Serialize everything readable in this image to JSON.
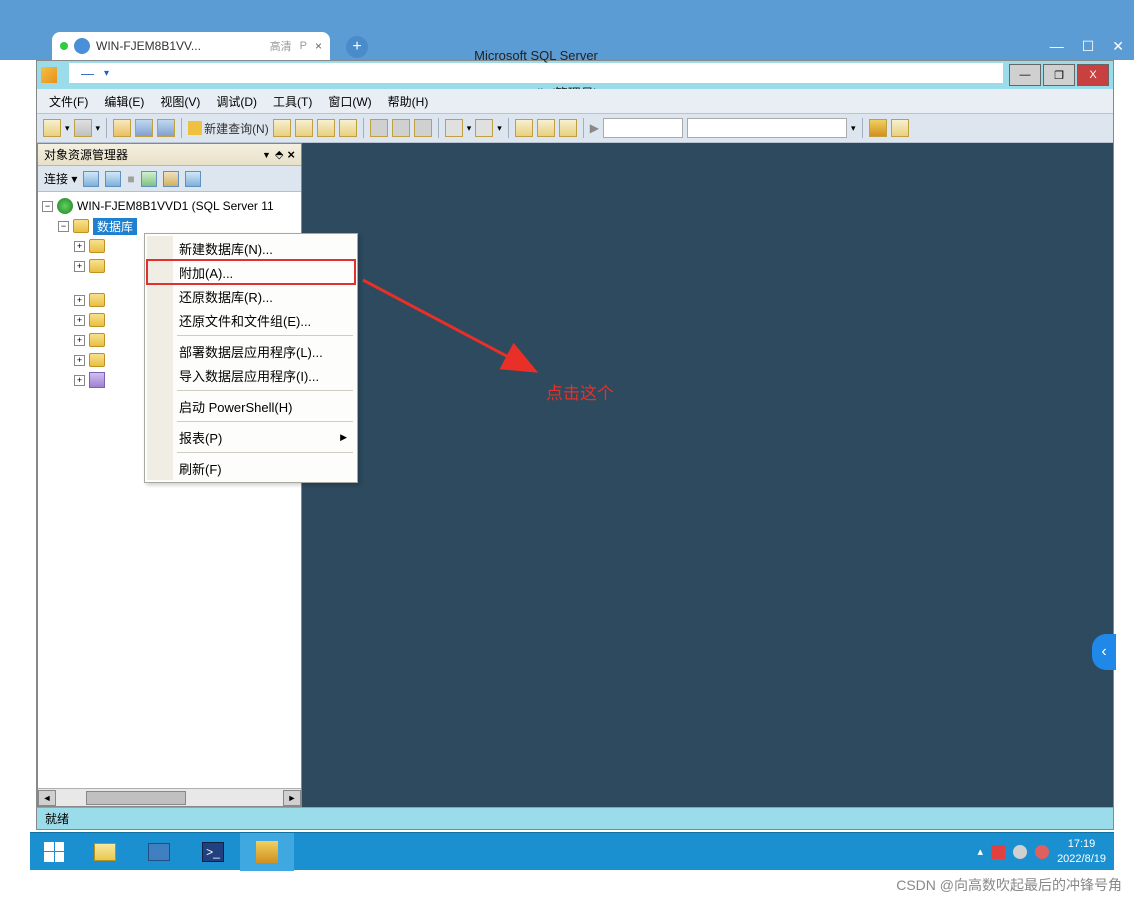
{
  "browser": {
    "tab_title": "WIN-FJEM8B1VV...",
    "tab_extra1": "高清",
    "tab_extra2": "P",
    "close": "×",
    "new_tab": "+"
  },
  "titlebar": {
    "title_left": "Microsoft SQL Server",
    "title_right": "ement Studio(管理员)",
    "dropdown": "—",
    "minimize": "—",
    "maximize": "❐",
    "close": "X"
  },
  "menu": {
    "file": "文件(F)",
    "edit": "编辑(E)",
    "view": "视图(V)",
    "debug": "调试(D)",
    "tools": "工具(T)",
    "window": "窗口(W)",
    "help": "帮助(H)"
  },
  "toolbar": {
    "new_query": "新建查询(N)",
    "play": "▶"
  },
  "object_explorer": {
    "title": "对象资源管理器",
    "dropdown": "▼",
    "pin": "⬘",
    "close": "×",
    "connect": "连接 ▾",
    "server": "WIN-FJEM8B1VVD1 (SQL Server 11",
    "selected_node": "数据库"
  },
  "context_menu": {
    "new_db": "新建数据库(N)...",
    "attach": "附加(A)...",
    "restore_db": "还原数据库(R)...",
    "restore_files": "还原文件和文件组(E)...",
    "deploy_dac": "部署数据层应用程序(L)...",
    "import_dac": "导入数据层应用程序(I)...",
    "powershell": "启动 PowerShell(H)",
    "reports": "报表(P)",
    "refresh": "刷新(F)",
    "arrow": "▶"
  },
  "annotation": {
    "text": "点击这个"
  },
  "status": {
    "ready": "就绪"
  },
  "taskbar": {
    "ps": ">_",
    "tray_up": "▴",
    "time": "17:19",
    "date": "2022/8/19"
  },
  "side_widget": "‹",
  "watermark": "CSDN @向高数吹起最后的冲锋号角"
}
